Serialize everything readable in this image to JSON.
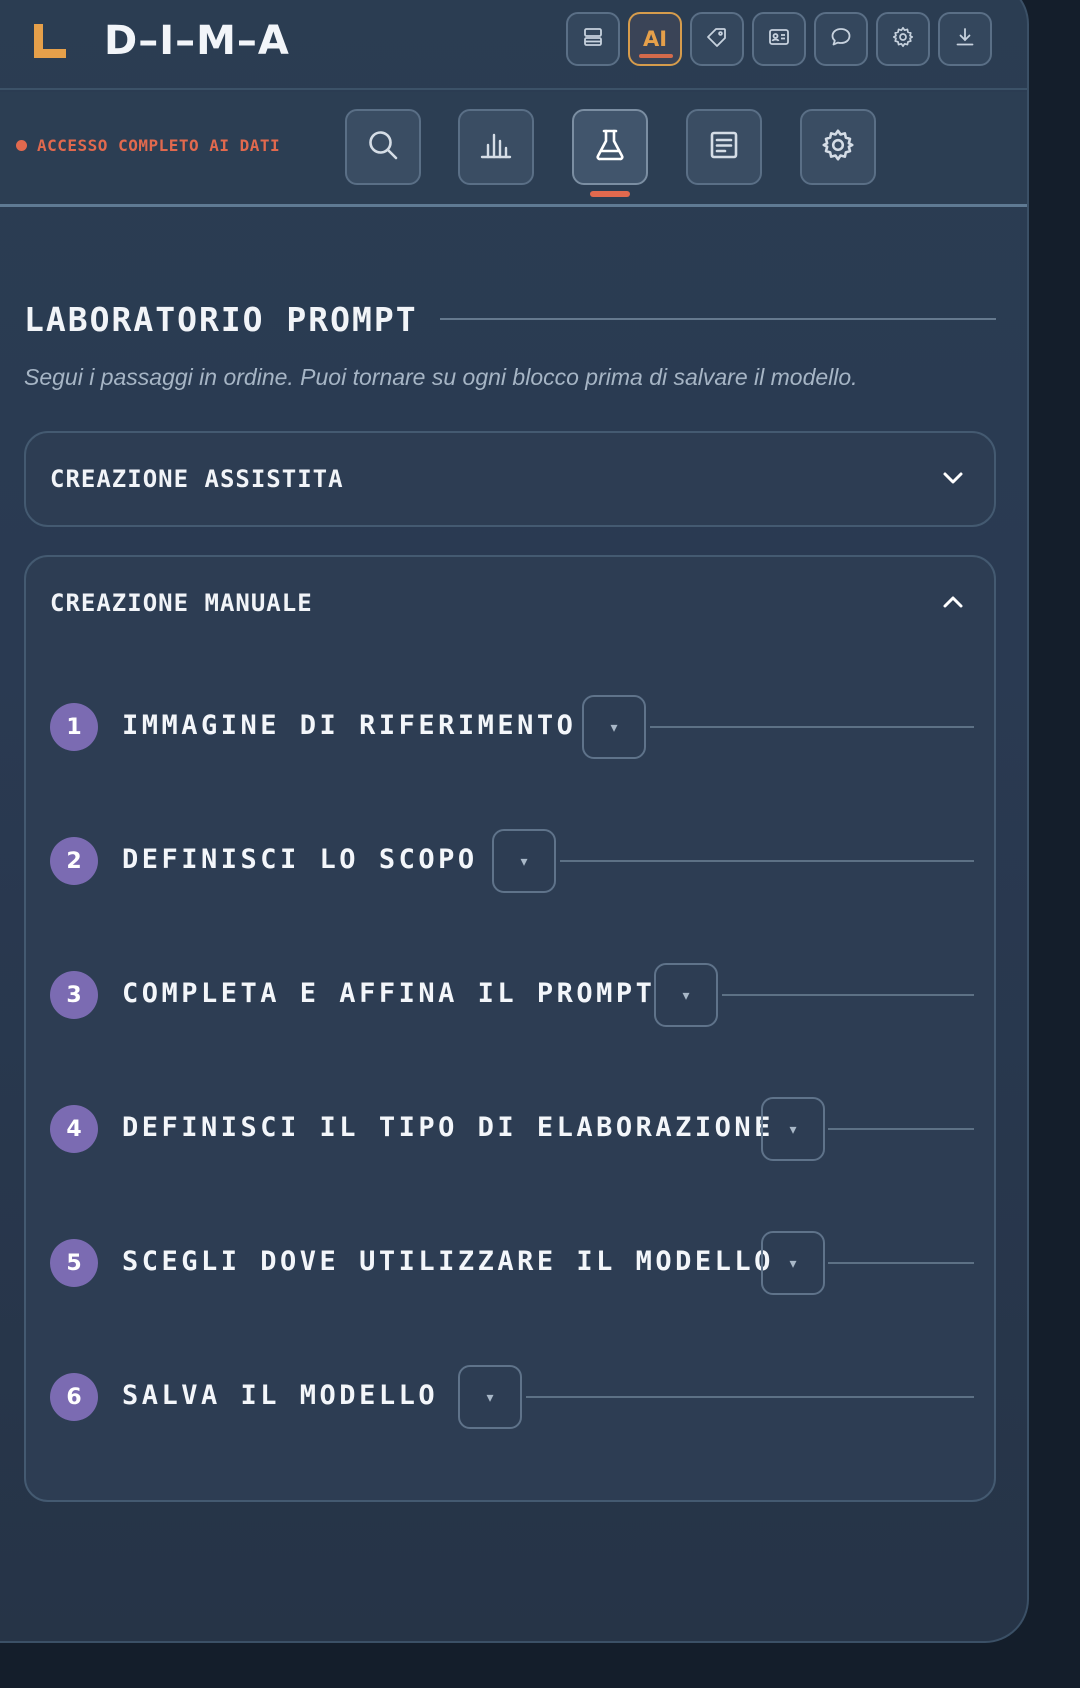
{
  "app": {
    "title": "D–I–M–A"
  },
  "toolbar": {
    "ai_label": "AI",
    "buttons": [
      {
        "icon": "database-icon",
        "active": false
      },
      {
        "icon": "ai-icon",
        "active": true
      },
      {
        "icon": "tag-icon",
        "active": false
      },
      {
        "icon": "id-card-icon",
        "active": false
      },
      {
        "icon": "chat-icon",
        "active": false
      },
      {
        "icon": "gear-icon",
        "active": false
      },
      {
        "icon": "download-icon",
        "active": false
      }
    ]
  },
  "subnav": {
    "access_text": "ACCESSO COMPLETO AI DATI",
    "access_color": "#e1694e",
    "tabs": [
      {
        "icon": "search-icon",
        "active": false
      },
      {
        "icon": "bar-chart-icon",
        "active": false
      },
      {
        "icon": "flask-icon",
        "active": true
      },
      {
        "icon": "document-icon",
        "active": false
      },
      {
        "icon": "gear-icon",
        "active": false
      }
    ]
  },
  "main": {
    "title": "LABORATORIO PROMPT",
    "subtitle": "Segui i passaggi in ordine. Puoi tornare su ogni blocco prima di salvare il modello.",
    "cards": [
      {
        "label": "CREAZIONE ASSISTITA",
        "expanded": false
      },
      {
        "label": "CREAZIONE MANUALE",
        "expanded": true
      }
    ],
    "steps": [
      {
        "number": "1",
        "title": "IMMAGINE DI RIFERIMENTO",
        "toggle": "▾"
      },
      {
        "number": "2",
        "title": "DEFINISCI LO SCOPO",
        "toggle": "▾"
      },
      {
        "number": "3",
        "title": "COMPLETA E AFFINA IL PROMPT",
        "toggle": "▾"
      },
      {
        "number": "4",
        "title": "DEFINISCI IL TIPO DI ELABORAZIONE",
        "toggle": "▾"
      },
      {
        "number": "5",
        "title": "SCEGLI DOVE UTILIZZARE IL MODELLO",
        "toggle": "▾"
      },
      {
        "number": "6",
        "title": "SALVA IL MODELLO",
        "toggle": "▾"
      }
    ]
  },
  "colors": {
    "accent": "#e6a04a",
    "danger": "#e1694e",
    "step_badge": "#7b6bb2",
    "background": "#141e2b"
  }
}
